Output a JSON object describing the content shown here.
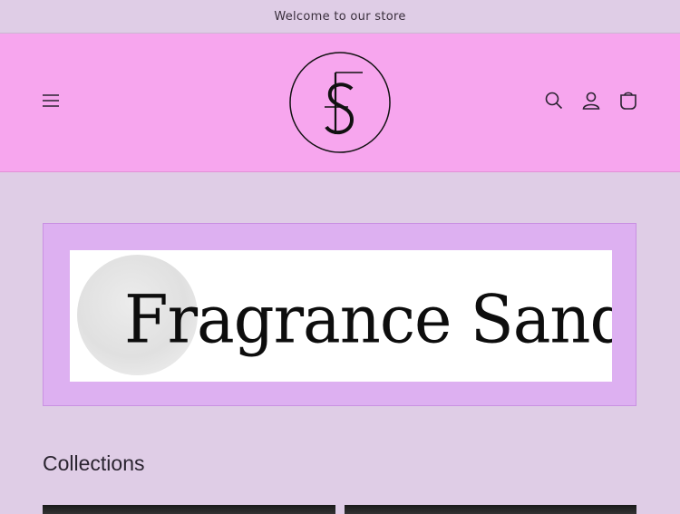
{
  "announcement": {
    "text": "Welcome to our store"
  },
  "header": {
    "menu_icon": "hamburger-menu-icon",
    "logo_monogram": "FS",
    "icons": [
      "search-icon",
      "account-icon",
      "cart-icon"
    ],
    "background_color": "#f7a6ee"
  },
  "banner": {
    "brand_text": "Fragrance Sand",
    "background_color": "#ddb0f1"
  },
  "collections": {
    "title": "Collections",
    "cards": [
      "collection-card-1",
      "collection-card-2"
    ]
  },
  "page_background": "#dfcde6"
}
